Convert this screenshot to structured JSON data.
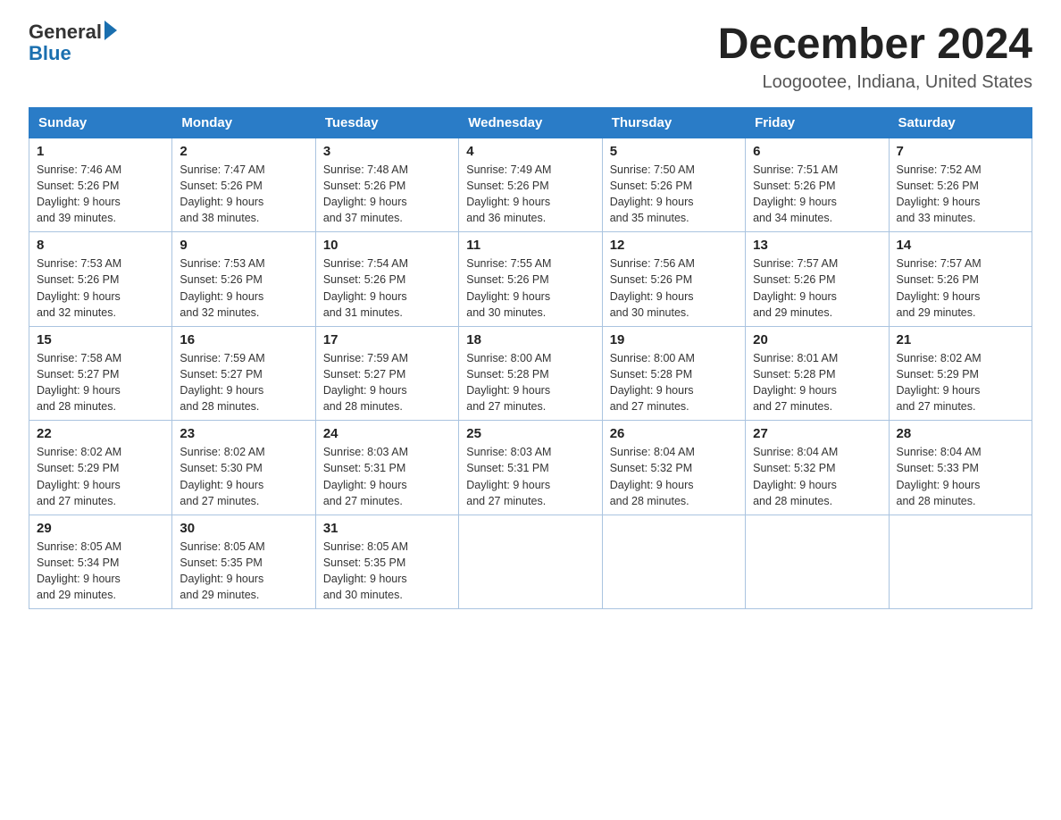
{
  "logo": {
    "general": "General",
    "blue": "Blue"
  },
  "title": "December 2024",
  "location": "Loogootee, Indiana, United States",
  "weekdays": [
    "Sunday",
    "Monday",
    "Tuesday",
    "Wednesday",
    "Thursday",
    "Friday",
    "Saturday"
  ],
  "weeks": [
    [
      {
        "day": "1",
        "sunrise": "7:46 AM",
        "sunset": "5:26 PM",
        "daylight": "9 hours and 39 minutes."
      },
      {
        "day": "2",
        "sunrise": "7:47 AM",
        "sunset": "5:26 PM",
        "daylight": "9 hours and 38 minutes."
      },
      {
        "day": "3",
        "sunrise": "7:48 AM",
        "sunset": "5:26 PM",
        "daylight": "9 hours and 37 minutes."
      },
      {
        "day": "4",
        "sunrise": "7:49 AM",
        "sunset": "5:26 PM",
        "daylight": "9 hours and 36 minutes."
      },
      {
        "day": "5",
        "sunrise": "7:50 AM",
        "sunset": "5:26 PM",
        "daylight": "9 hours and 35 minutes."
      },
      {
        "day": "6",
        "sunrise": "7:51 AM",
        "sunset": "5:26 PM",
        "daylight": "9 hours and 34 minutes."
      },
      {
        "day": "7",
        "sunrise": "7:52 AM",
        "sunset": "5:26 PM",
        "daylight": "9 hours and 33 minutes."
      }
    ],
    [
      {
        "day": "8",
        "sunrise": "7:53 AM",
        "sunset": "5:26 PM",
        "daylight": "9 hours and 32 minutes."
      },
      {
        "day": "9",
        "sunrise": "7:53 AM",
        "sunset": "5:26 PM",
        "daylight": "9 hours and 32 minutes."
      },
      {
        "day": "10",
        "sunrise": "7:54 AM",
        "sunset": "5:26 PM",
        "daylight": "9 hours and 31 minutes."
      },
      {
        "day": "11",
        "sunrise": "7:55 AM",
        "sunset": "5:26 PM",
        "daylight": "9 hours and 30 minutes."
      },
      {
        "day": "12",
        "sunrise": "7:56 AM",
        "sunset": "5:26 PM",
        "daylight": "9 hours and 30 minutes."
      },
      {
        "day": "13",
        "sunrise": "7:57 AM",
        "sunset": "5:26 PM",
        "daylight": "9 hours and 29 minutes."
      },
      {
        "day": "14",
        "sunrise": "7:57 AM",
        "sunset": "5:26 PM",
        "daylight": "9 hours and 29 minutes."
      }
    ],
    [
      {
        "day": "15",
        "sunrise": "7:58 AM",
        "sunset": "5:27 PM",
        "daylight": "9 hours and 28 minutes."
      },
      {
        "day": "16",
        "sunrise": "7:59 AM",
        "sunset": "5:27 PM",
        "daylight": "9 hours and 28 minutes."
      },
      {
        "day": "17",
        "sunrise": "7:59 AM",
        "sunset": "5:27 PM",
        "daylight": "9 hours and 28 minutes."
      },
      {
        "day": "18",
        "sunrise": "8:00 AM",
        "sunset": "5:28 PM",
        "daylight": "9 hours and 27 minutes."
      },
      {
        "day": "19",
        "sunrise": "8:00 AM",
        "sunset": "5:28 PM",
        "daylight": "9 hours and 27 minutes."
      },
      {
        "day": "20",
        "sunrise": "8:01 AM",
        "sunset": "5:28 PM",
        "daylight": "9 hours and 27 minutes."
      },
      {
        "day": "21",
        "sunrise": "8:02 AM",
        "sunset": "5:29 PM",
        "daylight": "9 hours and 27 minutes."
      }
    ],
    [
      {
        "day": "22",
        "sunrise": "8:02 AM",
        "sunset": "5:29 PM",
        "daylight": "9 hours and 27 minutes."
      },
      {
        "day": "23",
        "sunrise": "8:02 AM",
        "sunset": "5:30 PM",
        "daylight": "9 hours and 27 minutes."
      },
      {
        "day": "24",
        "sunrise": "8:03 AM",
        "sunset": "5:31 PM",
        "daylight": "9 hours and 27 minutes."
      },
      {
        "day": "25",
        "sunrise": "8:03 AM",
        "sunset": "5:31 PM",
        "daylight": "9 hours and 27 minutes."
      },
      {
        "day": "26",
        "sunrise": "8:04 AM",
        "sunset": "5:32 PM",
        "daylight": "9 hours and 28 minutes."
      },
      {
        "day": "27",
        "sunrise": "8:04 AM",
        "sunset": "5:32 PM",
        "daylight": "9 hours and 28 minutes."
      },
      {
        "day": "28",
        "sunrise": "8:04 AM",
        "sunset": "5:33 PM",
        "daylight": "9 hours and 28 minutes."
      }
    ],
    [
      {
        "day": "29",
        "sunrise": "8:05 AM",
        "sunset": "5:34 PM",
        "daylight": "9 hours and 29 minutes."
      },
      {
        "day": "30",
        "sunrise": "8:05 AM",
        "sunset": "5:35 PM",
        "daylight": "9 hours and 29 minutes."
      },
      {
        "day": "31",
        "sunrise": "8:05 AM",
        "sunset": "5:35 PM",
        "daylight": "9 hours and 30 minutes."
      },
      null,
      null,
      null,
      null
    ]
  ],
  "labels": {
    "sunrise": "Sunrise:",
    "sunset": "Sunset:",
    "daylight": "Daylight:"
  }
}
